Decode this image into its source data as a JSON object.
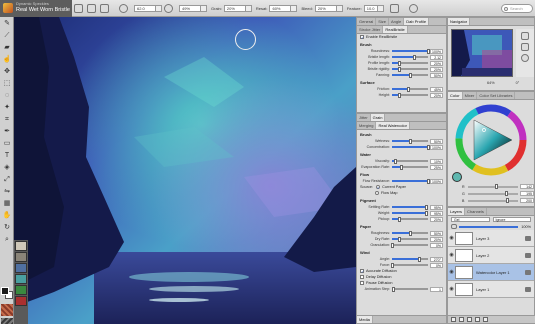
{
  "toolbar": {
    "brush_category": "Dynamic Speckles",
    "brush_variant": "Real Wet Worn Bristle",
    "size_value": "62.0",
    "opacity_value": "49%",
    "grain_label": "Grain:",
    "grain_value": "20%",
    "resat_label": "Resat:",
    "resat_value": "60%",
    "bleed_label": "Bleed:",
    "bleed_value": "20%",
    "feature_label": "Feature:",
    "feature_value": "10.0",
    "search_placeholder": "Search"
  },
  "tools": [
    "brush-tool",
    "dropper-tool",
    "eraser-tool",
    "smudge-tool",
    "layer-adjuster-tool",
    "selection-tool",
    "lasso-tool",
    "magic-wand-tool",
    "crop-tool",
    "pen-tool",
    "shape-tool",
    "text-tool",
    "paint-bucket-tool",
    "transform-tool",
    "mirror-tool",
    "perspective-tool",
    "grabber-tool",
    "rotate-tool",
    "magnifier-tool"
  ],
  "general_panel": {
    "tabs": [
      "General",
      "Size",
      "Angle",
      "Dab Profile"
    ],
    "subtabs": [
      "Stroke Jitter",
      "RealBristle"
    ],
    "enable_label": "Enable RealBristle",
    "brush_header": "Brush",
    "brush_rows": [
      {
        "label": "Roundness:",
        "value": "100%",
        "fill": 1.0
      },
      {
        "label": "Bristle length:",
        "value": "2.12",
        "fill": 0.62
      },
      {
        "label": "Profile length:",
        "value": "20%",
        "fill": 0.2
      },
      {
        "label": "Bristle rigidity:",
        "value": "20%",
        "fill": 0.2
      },
      {
        "label": "Fanning:",
        "value": "50%",
        "fill": 0.5
      }
    ],
    "surface_header": "Surface",
    "surface_rows": [
      {
        "label": "Friction:",
        "value": "45%",
        "fill": 0.45
      },
      {
        "label": "Height:",
        "value": "20%",
        "fill": 0.2
      }
    ]
  },
  "watercolor_panel": {
    "tabs": [
      "Jitter",
      "Grain"
    ],
    "subtabs": [
      "Merging",
      "Real Watercolor"
    ],
    "brush_header": "Brush",
    "brush_rows": [
      {
        "label": "Wetness:",
        "value": "50%",
        "fill": 0.5
      },
      {
        "label": "Concentration:",
        "value": "100%",
        "fill": 1.0
      }
    ],
    "water_header": "Water",
    "water_rows": [
      {
        "label": "Viscosity:",
        "value": "10%",
        "fill": 0.1
      },
      {
        "label": "Evaporation Rate:",
        "value": "25%",
        "fill": 0.25
      }
    ],
    "flow_header": "Flow",
    "flow_rows": [
      {
        "label": "Flow Resistance:",
        "value": "100%",
        "fill": 1.0
      }
    ],
    "source_label": "Source:",
    "current_paper": "Current Paper",
    "flow_map": "Flow Map",
    "pigment_header": "Pigment",
    "pigment_rows": [
      {
        "label": "Settling Rate:",
        "value": "95%",
        "fill": 0.95
      },
      {
        "label": "Weight:",
        "value": "95%",
        "fill": 0.95
      },
      {
        "label": "Pickup:",
        "value": "20%",
        "fill": 0.2
      }
    ],
    "paper_header": "Paper",
    "paper_rows": [
      {
        "label": "Roughness:",
        "value": "50%",
        "fill": 0.5
      },
      {
        "label": "Dry Rate:",
        "value": "20%",
        "fill": 0.2
      },
      {
        "label": "Granulation:",
        "value": "0%",
        "fill": 0.0
      }
    ],
    "wind_header": "Wind",
    "wind_rows": [
      {
        "label": "Angle:",
        "value": "270°",
        "fill": 0.75
      },
      {
        "label": "Force:",
        "value": "0%",
        "fill": 0.0
      }
    ],
    "checks": [
      {
        "label": "Accurate Diffusion",
        "checked": true
      },
      {
        "label": "Delay Diffusion",
        "checked": false
      },
      {
        "label": "Pause Diffusion",
        "checked": false
      }
    ],
    "animation_row": {
      "label": "Animation Step:",
      "value": "1",
      "fill": 0.05
    },
    "footer_tab": "Media"
  },
  "navigator": {
    "title": "Navigator",
    "zoom": "64%",
    "angle": "0°"
  },
  "color_panel": {
    "tabs": [
      "Color",
      "Mixer",
      "Color Set Libraries"
    ],
    "rgb": [
      {
        "label": "R",
        "value": "142",
        "fill": 0.56
      },
      {
        "label": "G",
        "value": "195",
        "fill": 0.76
      },
      {
        "label": "B",
        "value": "200",
        "fill": 0.78
      }
    ],
    "current_color": "#5fb8b0"
  },
  "layers_panel": {
    "tabs": [
      "Layers",
      "Channels"
    ],
    "blend_mode": "Gel",
    "composite": "Ignore",
    "opacity": "100%",
    "layers": [
      {
        "name": "Layer 3",
        "active": false
      },
      {
        "name": "Layer 2",
        "active": false
      },
      {
        "name": "Watercolor Layer 1",
        "active": true
      },
      {
        "name": "Layer 1",
        "active": false
      }
    ]
  }
}
